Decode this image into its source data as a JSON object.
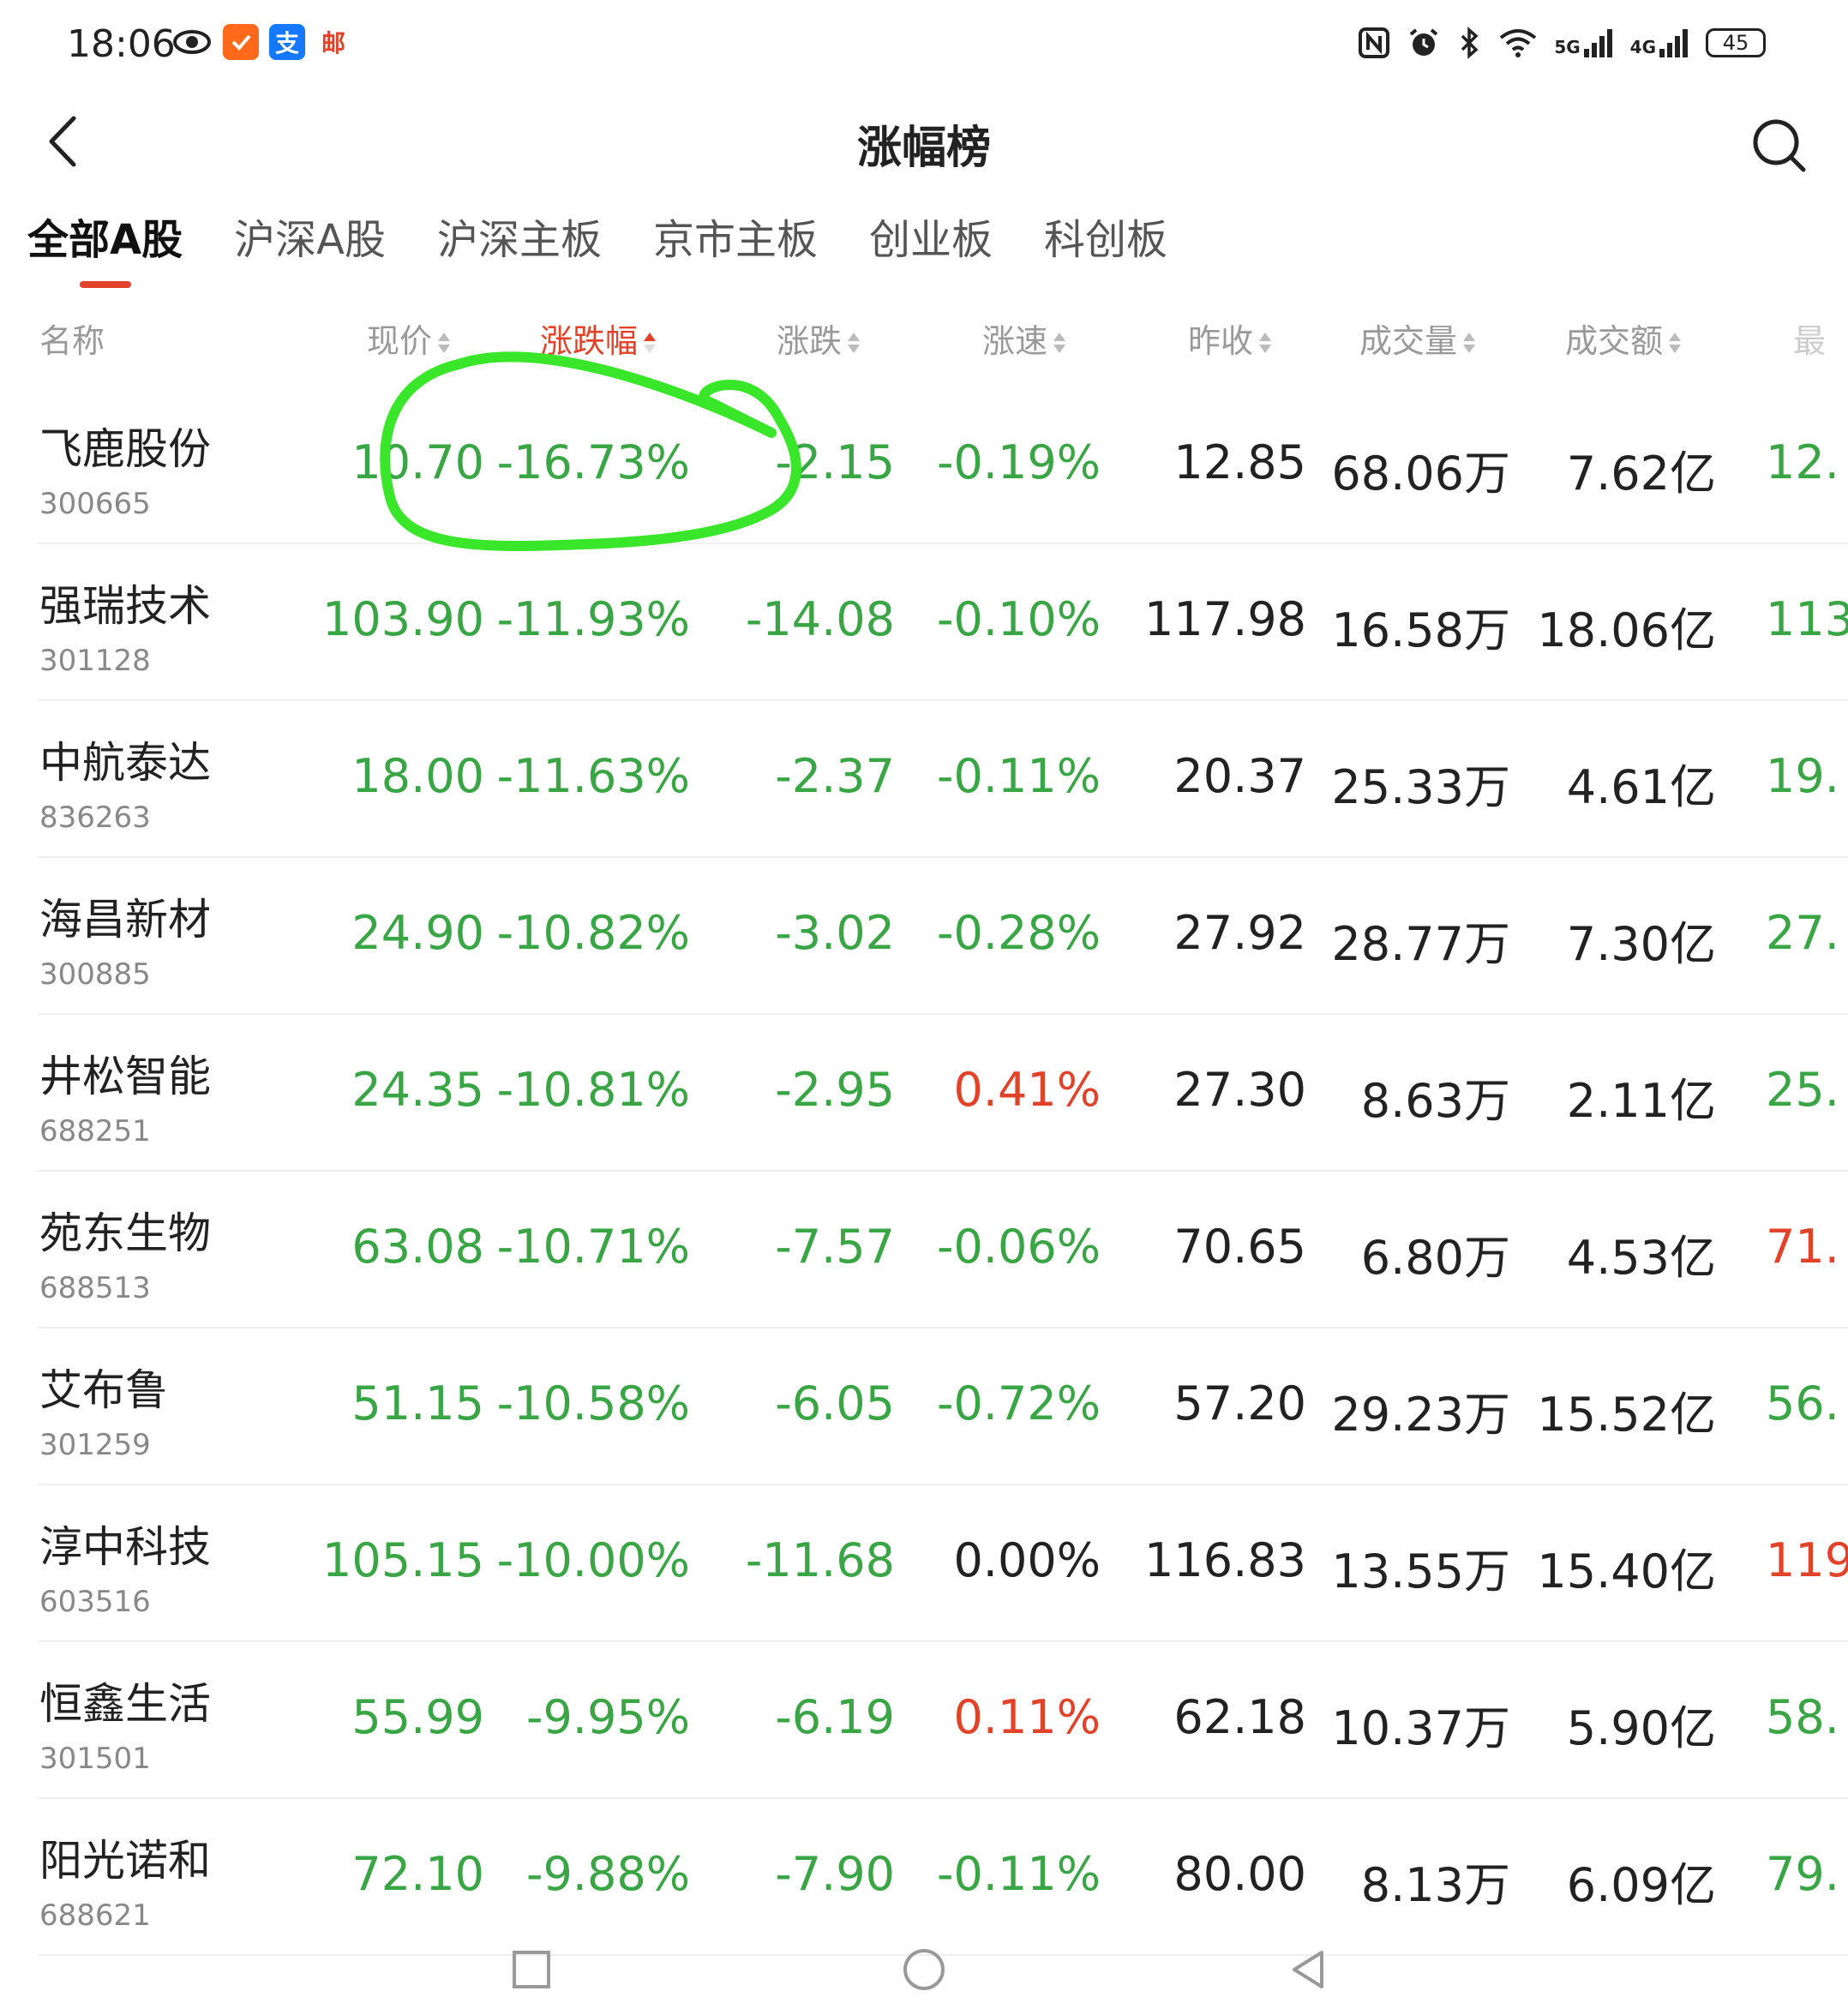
{
  "status_bar": {
    "time": "18:06",
    "app_icons": [
      "eye-icon",
      "checkmark-app-icon",
      "alipay-icon",
      "mail-icon"
    ],
    "right_icons": [
      "nfc-icon",
      "alarm-icon",
      "bluetooth-icon",
      "wifi-icon",
      "signal-5g-icon",
      "signal-4g-icon"
    ],
    "signal_5g_label": "5G",
    "signal_4g_label": "4G",
    "battery": "45",
    "alipay_label": "支",
    "mail_label": "邮"
  },
  "header": {
    "title": "涨幅榜"
  },
  "tabs": [
    {
      "label": "全部A股",
      "active": true
    },
    {
      "label": "沪深A股",
      "active": false
    },
    {
      "label": "沪深主板",
      "active": false
    },
    {
      "label": "京市主板",
      "active": false
    },
    {
      "label": "创业板",
      "active": false
    },
    {
      "label": "科创板",
      "active": false
    }
  ],
  "columns": {
    "name": "名称",
    "price": "现价",
    "pct": "涨跌幅",
    "chg": "涨跌",
    "speed": "涨速",
    "prev": "昨收",
    "vol": "成交量",
    "amt": "成交额",
    "high": "最"
  },
  "colors": {
    "up": "#e0432a",
    "down": "#3aa545",
    "flat": "#222222",
    "annotation": "#39e629"
  },
  "rows": [
    {
      "name": "飞鹿股份",
      "code": "300665",
      "price": "10.70",
      "pct": "-16.73%",
      "chg": "-2.15",
      "speed": "-0.19%",
      "speed_dir": "down",
      "prev": "12.85",
      "vol": "68.06万",
      "amt": "7.62亿",
      "high": "12.",
      "high_dir": "down"
    },
    {
      "name": "强瑞技术",
      "code": "301128",
      "price": "103.90",
      "pct": "-11.93%",
      "chg": "-14.08",
      "speed": "-0.10%",
      "speed_dir": "down",
      "prev": "117.98",
      "vol": "16.58万",
      "amt": "18.06亿",
      "high": "113.",
      "high_dir": "down"
    },
    {
      "name": "中航泰达",
      "code": "836263",
      "price": "18.00",
      "pct": "-11.63%",
      "chg": "-2.37",
      "speed": "-0.11%",
      "speed_dir": "down",
      "prev": "20.37",
      "vol": "25.33万",
      "amt": "4.61亿",
      "high": "19.",
      "high_dir": "down"
    },
    {
      "name": "海昌新材",
      "code": "300885",
      "price": "24.90",
      "pct": "-10.82%",
      "chg": "-3.02",
      "speed": "-0.28%",
      "speed_dir": "down",
      "prev": "27.92",
      "vol": "28.77万",
      "amt": "7.30亿",
      "high": "27.",
      "high_dir": "down"
    },
    {
      "name": "井松智能",
      "code": "688251",
      "price": "24.35",
      "pct": "-10.81%",
      "chg": "-2.95",
      "speed": "0.41%",
      "speed_dir": "up",
      "prev": "27.30",
      "vol": "8.63万",
      "amt": "2.11亿",
      "high": "25.",
      "high_dir": "down"
    },
    {
      "name": "苑东生物",
      "code": "688513",
      "price": "63.08",
      "pct": "-10.71%",
      "chg": "-7.57",
      "speed": "-0.06%",
      "speed_dir": "down",
      "prev": "70.65",
      "vol": "6.80万",
      "amt": "4.53亿",
      "high": "71.",
      "high_dir": "up"
    },
    {
      "name": "艾布鲁",
      "code": "301259",
      "price": "51.15",
      "pct": "-10.58%",
      "chg": "-6.05",
      "speed": "-0.72%",
      "speed_dir": "down",
      "prev": "57.20",
      "vol": "29.23万",
      "amt": "15.52亿",
      "high": "56.",
      "high_dir": "down"
    },
    {
      "name": "淳中科技",
      "code": "603516",
      "price": "105.15",
      "pct": "-10.00%",
      "chg": "-11.68",
      "speed": "0.00%",
      "speed_dir": "flat",
      "prev": "116.83",
      "vol": "13.55万",
      "amt": "15.40亿",
      "high": "119.",
      "high_dir": "up"
    },
    {
      "name": "恒鑫生活",
      "code": "301501",
      "price": "55.99",
      "pct": "-9.95%",
      "chg": "-6.19",
      "speed": "0.11%",
      "speed_dir": "up",
      "prev": "62.18",
      "vol": "10.37万",
      "amt": "5.90亿",
      "high": "58.",
      "high_dir": "down"
    },
    {
      "name": "阳光诺和",
      "code": "688621",
      "price": "72.10",
      "pct": "-9.88%",
      "chg": "-7.90",
      "speed": "-0.11%",
      "speed_dir": "down",
      "prev": "80.00",
      "vol": "8.13万",
      "amt": "6.09亿",
      "high": "79.",
      "high_dir": "down"
    }
  ],
  "nav_bar": {
    "icons": [
      "recent-apps-icon",
      "home-icon",
      "back-nav-icon"
    ]
  }
}
